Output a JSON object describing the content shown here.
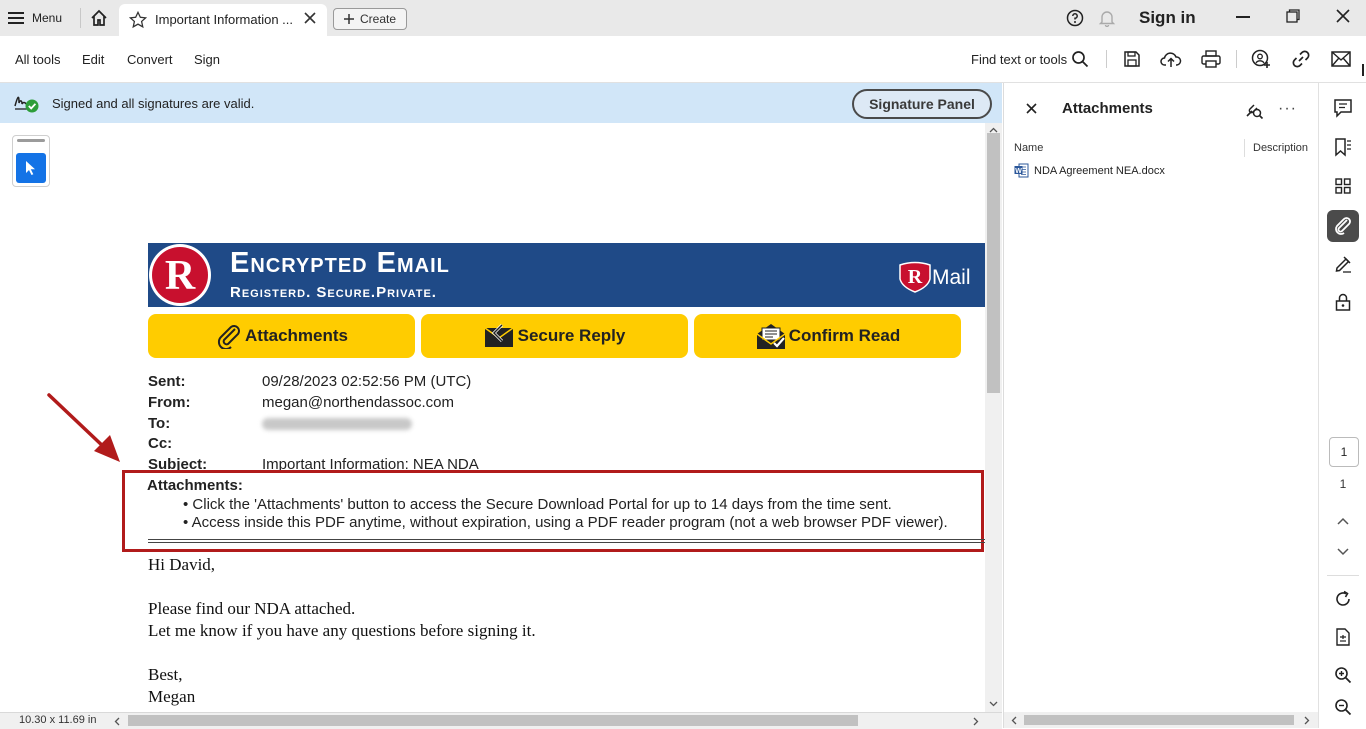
{
  "tabbar": {
    "menu_label": "Menu",
    "tab_title": "Important Information ...",
    "create_label": "Create",
    "signin_label": "Sign in"
  },
  "toolbar": {
    "items": [
      "All tools",
      "Edit",
      "Convert",
      "Sign"
    ],
    "find_label": "Find text or tools"
  },
  "signature_bar": {
    "status_text": "Signed and all signatures are valid.",
    "panel_button": "Signature Panel"
  },
  "email": {
    "banner_title": "Encrypted Email",
    "banner_subtitle": "Registerd. Secure.Private.",
    "logo_right": "RMail",
    "buttons": [
      "Attachments",
      "Secure Reply",
      "Confirm Read"
    ],
    "meta": {
      "sent_label": "Sent:",
      "sent_value": "09/28/2023 02:52:56 PM (UTC)",
      "from_label": "From:",
      "from_value": "megan@northendassoc.com",
      "to_label": "To:",
      "cc_label": "Cc:",
      "subject_label": "Subject:",
      "subject_value": "Important Information: NEA NDA"
    },
    "attachments_heading": "Attachments:",
    "attachments_notes": [
      "• Click the 'Attachments' button to access the Secure Download Portal for up to 14 days from the time sent.",
      "• Access inside this PDF anytime, without expiration, using a PDF reader program (not a web browser PDF viewer)."
    ],
    "body": [
      "Hi David,",
      "Please find our NDA attached.",
      "Let me know if you have any questions before signing it.",
      "Best,",
      "Megan"
    ]
  },
  "statusbar": {
    "page_size": "10.30 x 11.69 in"
  },
  "attachments_panel": {
    "title": "Attachments",
    "col_name": "Name",
    "col_description": "Description",
    "files": [
      "NDA Agreement NEA.docx"
    ]
  },
  "rail": {
    "current_page": "1",
    "total_pages": "1"
  },
  "colors": {
    "banner_blue": "#1f4a87",
    "button_yellow": "#ffcc00",
    "highlight_red": "#b11b1b",
    "sig_bar": "#d1e6f8",
    "accent_blue": "#1473e6"
  }
}
